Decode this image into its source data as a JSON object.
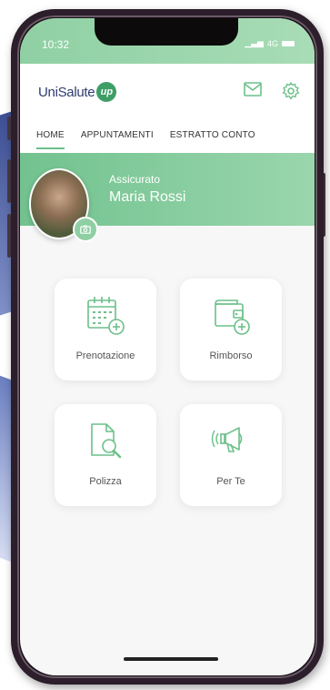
{
  "status_bar": {
    "time": "10:32",
    "signal": "4G"
  },
  "header": {
    "logo_text": "UniSalute",
    "logo_badge": "up",
    "icons": [
      "mail-icon",
      "gear-icon"
    ]
  },
  "tabs": [
    {
      "label": "HOME",
      "active": true
    },
    {
      "label": "APPUNTAMENTI",
      "active": false
    },
    {
      "label": "ESTRATTO CONTO",
      "active": false
    }
  ],
  "profile": {
    "role": "Assicurato",
    "name": "Maria Rossi"
  },
  "tiles": [
    {
      "label": "Prenotazione",
      "icon": "calendar-plus-icon"
    },
    {
      "label": "Rimborso",
      "icon": "wallet-plus-icon"
    },
    {
      "label": "Polizza",
      "icon": "document-search-icon"
    },
    {
      "label": "Per Te",
      "icon": "megaphone-icon"
    }
  ],
  "colors": {
    "accent": "#6cc08a",
    "brand_blue": "#2e3d70"
  }
}
